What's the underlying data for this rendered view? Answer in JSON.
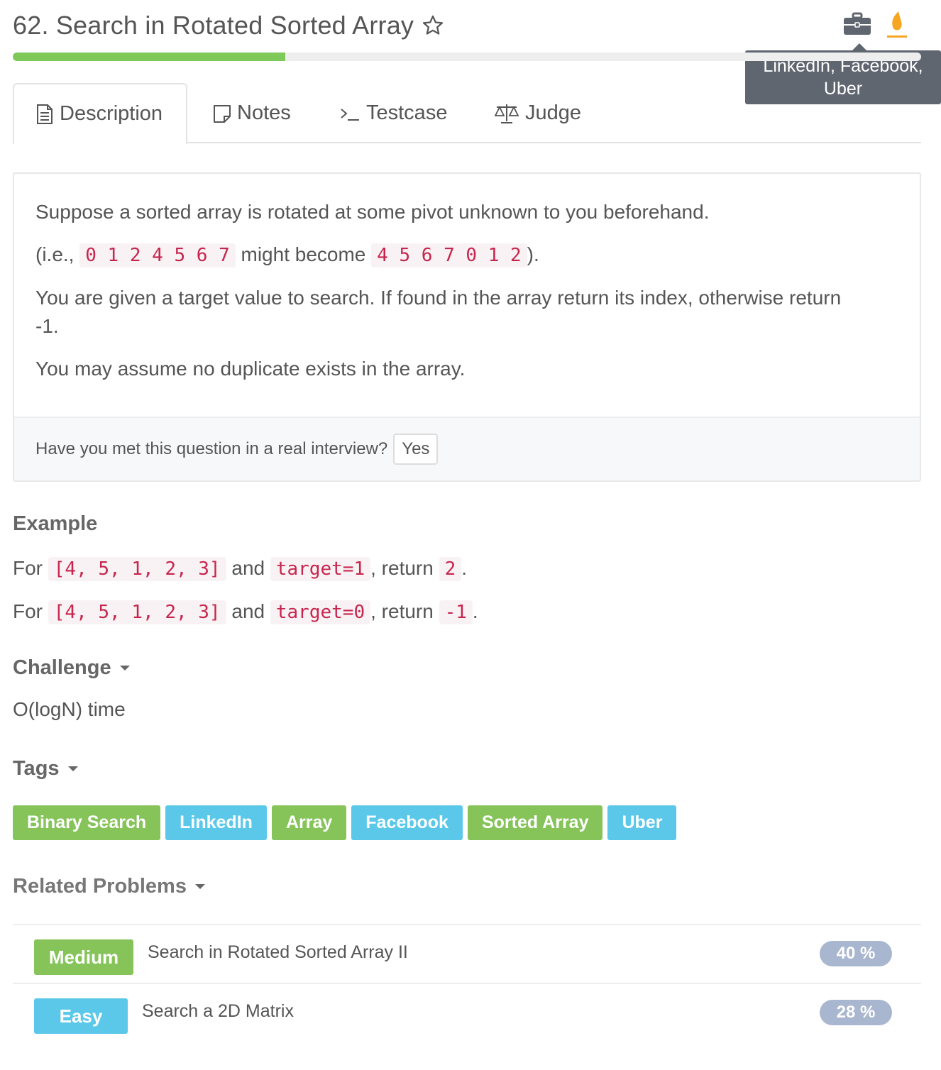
{
  "problem": {
    "title": "62. Search in Rotated Sorted Array",
    "progress_percent": 30,
    "companies_tooltip": "LinkedIn, Facebook, Uber"
  },
  "tabs": [
    {
      "label": "Description",
      "icon": "document-icon",
      "active": true
    },
    {
      "label": "Notes",
      "icon": "note-icon",
      "active": false
    },
    {
      "label": "Testcase",
      "icon": "terminal-icon",
      "active": false
    },
    {
      "label": "Judge",
      "icon": "scale-icon",
      "active": false
    }
  ],
  "description": {
    "p1": "Suppose a sorted array is rotated at some pivot unknown to you beforehand.",
    "p2_prefix": "(i.e., ",
    "p2_code1": "0 1 2 4 5 6 7",
    "p2_mid": " might become ",
    "p2_code2": "4 5 6 7 0 1 2",
    "p2_suffix": ").",
    "p3": "You are given a target value to search. If found in the array return its index, otherwise return -1.",
    "p4": "You may assume no duplicate exists in the array.",
    "interview_question": "Have you met this question in a real interview?",
    "yes_label": "Yes"
  },
  "example": {
    "heading": "Example",
    "lines": [
      {
        "for": "For ",
        "array": "[4, 5, 1, 2, 3]",
        "and": " and ",
        "target": "target=1",
        "return": ", return ",
        "result": "2",
        "end": "."
      },
      {
        "for": "For ",
        "array": "[4, 5, 1, 2, 3]",
        "and": " and ",
        "target": "target=0",
        "return": ", return ",
        "result": "-1",
        "end": "."
      }
    ]
  },
  "challenge": {
    "heading": "Challenge",
    "text": "O(logN) time"
  },
  "tags": {
    "heading": "Tags",
    "items": [
      {
        "label": "Binary Search",
        "color": "#86c45a"
      },
      {
        "label": "LinkedIn",
        "color": "#5bc8ea"
      },
      {
        "label": "Array",
        "color": "#86c45a"
      },
      {
        "label": "Facebook",
        "color": "#5bc8ea"
      },
      {
        "label": "Sorted Array",
        "color": "#86c45a"
      },
      {
        "label": "Uber",
        "color": "#5bc8ea"
      }
    ]
  },
  "related": {
    "heading": "Related Problems",
    "items": [
      {
        "difficulty": "Medium",
        "difficulty_color": "#86c45a",
        "title": "Search in Rotated Sorted Array II",
        "rate": "40 %"
      },
      {
        "difficulty": "Easy",
        "difficulty_color": "#5bc8ea",
        "title": "Search a 2D Matrix",
        "rate": "28 %"
      }
    ]
  },
  "colors": {
    "accent_green": "#7ec95a",
    "code_red": "#c7254e",
    "flame_orange": "#f5a623"
  }
}
